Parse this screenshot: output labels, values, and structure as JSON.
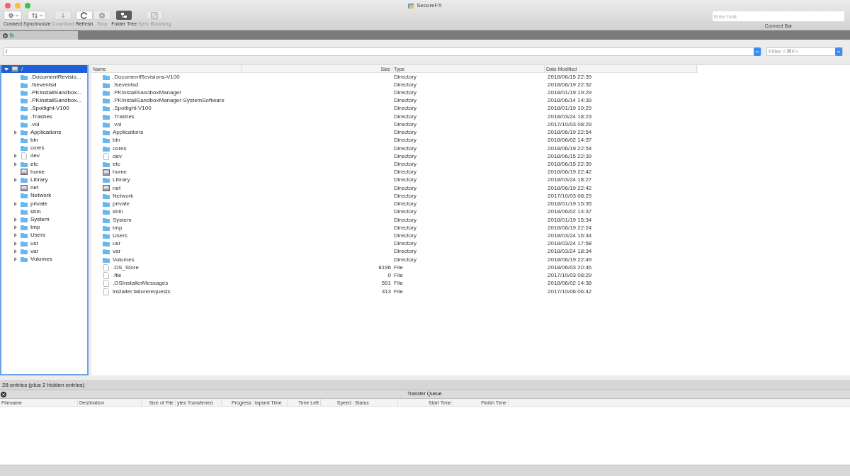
{
  "window": {
    "title": "SecureFX"
  },
  "toolbar": [
    {
      "label": "Connect",
      "dropdown": true,
      "disabled": false,
      "on": false
    },
    {
      "label": "Synchronize",
      "dropdown": true,
      "disabled": false,
      "on": false
    },
    {
      "label": "Download",
      "dropdown": false,
      "disabled": true,
      "on": false
    },
    {
      "label": "Refresh",
      "dropdown": false,
      "disabled": false,
      "on": false
    },
    {
      "label": "Stop",
      "dropdown": false,
      "disabled": true,
      "on": false
    },
    {
      "label": "Folder Tree",
      "dropdown": false,
      "disabled": false,
      "on": true
    },
    {
      "label": "Sync Browsing",
      "dropdown": false,
      "disabled": true,
      "on": false
    }
  ],
  "connect_bar": {
    "placeholder": "Enter host",
    "label": "Connect Bar"
  },
  "path_field": {
    "value": "/"
  },
  "filter_field": {
    "placeholder": "Filter <⌘F>"
  },
  "tree": {
    "label": "/",
    "kind": "drive",
    "expanded": true,
    "selected": true,
    "children": [
      {
        "label": ".DocumentRevisio...",
        "kind": "folder",
        "expandable": false
      },
      {
        "label": ".fseventsd",
        "kind": "folder",
        "expandable": false
      },
      {
        "label": ".PKInstallSandbox...",
        "kind": "folder",
        "expandable": false
      },
      {
        "label": ".PKInstallSandbox...",
        "kind": "folder",
        "expandable": false
      },
      {
        "label": ".Spotlight-V100",
        "kind": "folder",
        "expandable": false
      },
      {
        "label": ".Trashes",
        "kind": "folder",
        "expandable": false
      },
      {
        "label": ".vol",
        "kind": "folder",
        "expandable": false
      },
      {
        "label": "Applications",
        "kind": "folder",
        "expandable": true
      },
      {
        "label": "bin",
        "kind": "folder",
        "expandable": false
      },
      {
        "label": "cores",
        "kind": "folder",
        "expandable": false
      },
      {
        "label": "dev",
        "kind": "file",
        "expandable": true
      },
      {
        "label": "etc",
        "kind": "folder",
        "expandable": true
      },
      {
        "label": "home",
        "kind": "drive",
        "expandable": false
      },
      {
        "label": "Library",
        "kind": "folder",
        "expandable": true
      },
      {
        "label": "net",
        "kind": "drive",
        "expandable": false
      },
      {
        "label": "Network",
        "kind": "folder",
        "expandable": false
      },
      {
        "label": "private",
        "kind": "folder",
        "expandable": true
      },
      {
        "label": "sbin",
        "kind": "folder",
        "expandable": false
      },
      {
        "label": "System",
        "kind": "folder",
        "expandable": true
      },
      {
        "label": "tmp",
        "kind": "folder",
        "expandable": true
      },
      {
        "label": "Users",
        "kind": "folder",
        "expandable": true
      },
      {
        "label": "usr",
        "kind": "folder",
        "expandable": true
      },
      {
        "label": "var",
        "kind": "folder",
        "expandable": true
      },
      {
        "label": "Volumes",
        "kind": "folder",
        "expandable": true
      }
    ]
  },
  "file_list": {
    "columns": [
      "Name",
      "Size",
      "Type",
      "Date Modified"
    ],
    "rows": [
      {
        "name": ".DocumentRevisions-V100",
        "kind": "folder",
        "type": "Directory",
        "modified": "2018/06/15 22:39"
      },
      {
        "name": ".fseventsd",
        "kind": "folder",
        "type": "Directory",
        "modified": "2018/06/19 22:32"
      },
      {
        "name": ".PKInstallSandboxManager",
        "kind": "folder",
        "type": "Directory",
        "modified": "2018/01/19 19:29"
      },
      {
        "name": ".PKInstallSandboxManager-SystemSoftware",
        "kind": "folder",
        "type": "Directory",
        "modified": "2018/06/14 14:39"
      },
      {
        "name": ".Spotlight-V100",
        "kind": "folder",
        "type": "Directory",
        "modified": "2018/01/19 19:29"
      },
      {
        "name": ".Trashes",
        "kind": "folder",
        "type": "Directory",
        "modified": "2018/03/24 18:23"
      },
      {
        "name": ".vol",
        "kind": "folder",
        "type": "Directory",
        "modified": "2017/10/03 08:29"
      },
      {
        "name": "Applications",
        "kind": "folder",
        "type": "Directory",
        "modified": "2018/06/19 22:54"
      },
      {
        "name": "bin",
        "kind": "folder",
        "type": "Directory",
        "modified": "2018/06/02 14:37"
      },
      {
        "name": "cores",
        "kind": "folder",
        "type": "Directory",
        "modified": "2018/06/19 22:54"
      },
      {
        "name": "dev",
        "kind": "file",
        "type": "Directory",
        "modified": "2018/06/15 22:39"
      },
      {
        "name": "etc",
        "kind": "folder",
        "type": "Directory",
        "modified": "2018/06/15 22:39"
      },
      {
        "name": "home",
        "kind": "drive",
        "type": "Directory",
        "modified": "2018/06/19 22:42"
      },
      {
        "name": "Library",
        "kind": "folder",
        "type": "Directory",
        "modified": "2018/03/24 18:27"
      },
      {
        "name": "net",
        "kind": "drive",
        "type": "Directory",
        "modified": "2018/06/19 22:42"
      },
      {
        "name": "Network",
        "kind": "folder",
        "type": "Directory",
        "modified": "2017/10/03 08:29"
      },
      {
        "name": "private",
        "kind": "folder",
        "type": "Directory",
        "modified": "2018/01/19 15:35"
      },
      {
        "name": "sbin",
        "kind": "folder",
        "type": "Directory",
        "modified": "2018/06/02 14:37"
      },
      {
        "name": "System",
        "kind": "folder",
        "type": "Directory",
        "modified": "2018/01/19 15:34"
      },
      {
        "name": "tmp",
        "kind": "folder",
        "type": "Directory",
        "modified": "2018/06/19 22:24"
      },
      {
        "name": "Users",
        "kind": "folder",
        "type": "Directory",
        "modified": "2018/03/24 16:34"
      },
      {
        "name": "usr",
        "kind": "folder",
        "type": "Directory",
        "modified": "2018/03/24 17:58"
      },
      {
        "name": "var",
        "kind": "folder",
        "type": "Directory",
        "modified": "2018/03/24 18:34"
      },
      {
        "name": "Volumes",
        "kind": "folder",
        "type": "Directory",
        "modified": "2018/06/19 22:49"
      },
      {
        "name": ".DS_Store",
        "kind": "file",
        "size": "8196",
        "type": "File",
        "modified": "2018/06/03 20:46"
      },
      {
        "name": ".file",
        "kind": "file",
        "size": "0",
        "type": "File",
        "modified": "2017/10/03 08:29"
      },
      {
        "name": ".OSInstallerMessages",
        "kind": "file",
        "size": "591",
        "type": "File",
        "modified": "2018/06/02 14:38"
      },
      {
        "name": "installer.failurerequests",
        "kind": "file",
        "size": "313",
        "type": "File",
        "modified": "2017/10/06 06:42"
      }
    ]
  },
  "status_bar": "28 entries (plus 2 hidden entries)",
  "transfer_queue": {
    "title": "Transfer Queue",
    "columns": [
      "Filename",
      "Destination",
      "Size of File",
      "ytes Transferred",
      "Progress",
      "lapsed Time",
      "Time Left",
      "Speed",
      "Status",
      "Start Time",
      "Finish Time"
    ]
  }
}
